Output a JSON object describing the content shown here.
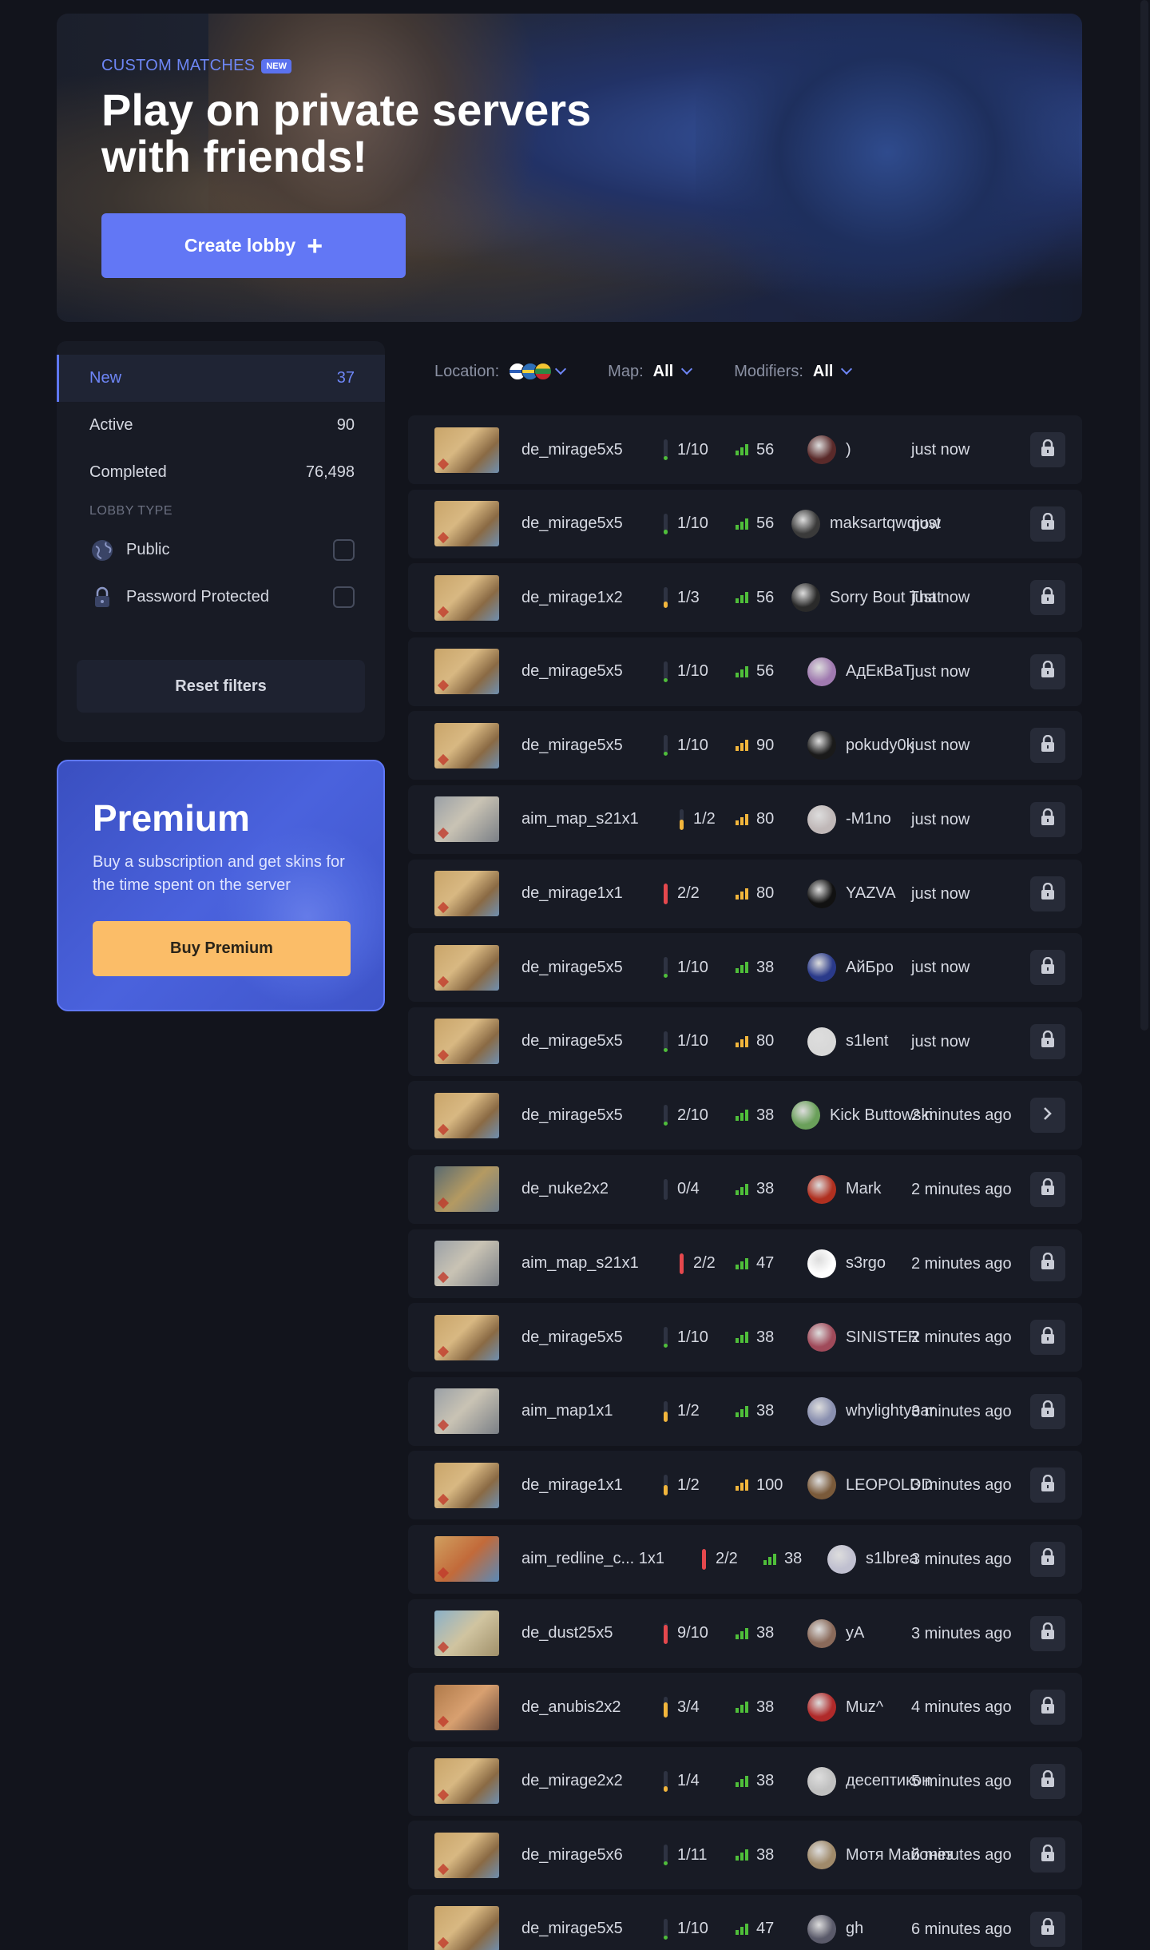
{
  "hero": {
    "eyebrow": "CUSTOM MATCHES",
    "badge": "NEW",
    "title": "Play on private servers with friends!",
    "create_button": "Create lobby",
    "create_icon": "plus-icon"
  },
  "sidebar": {
    "statuses": [
      {
        "label": "New",
        "count": "37",
        "active": true
      },
      {
        "label": "Active",
        "count": "90",
        "active": false
      },
      {
        "label": "Completed",
        "count": "76,498",
        "active": false
      }
    ],
    "lobby_type_label": "LOBBY TYPE",
    "types": [
      {
        "label": "Public",
        "icon": "globe-icon"
      },
      {
        "label": "Password Protected",
        "icon": "lock-icon"
      }
    ],
    "reset_label": "Reset filters"
  },
  "premium": {
    "title": "Premium",
    "text": "Buy a subscription and get skins for the time spent on the server",
    "button": "Buy Premium"
  },
  "filters": {
    "location_label": "Location:",
    "map_label": "Map:",
    "map_value": "All",
    "modifiers_label": "Modifiers:",
    "modifiers_value": "All"
  },
  "colors": {
    "accent": "#5f78f7",
    "premium_button": "#fbbd68",
    "ping_green": "#4fbf3a",
    "ping_yellow": "#f2b63c",
    "players_red": "#e5484d"
  },
  "lobbies": [
    {
      "map": "de_mirage5x5",
      "players": "1/10",
      "fill": 0.1,
      "ping": "56",
      "ping_color": "green",
      "host": ")",
      "time": "just now",
      "action": "lock-icon"
    },
    {
      "map": "de_mirage5x5",
      "players": "1/10",
      "fill": 0.1,
      "ping": "56",
      "ping_color": "green",
      "host": "maksartqwqjust",
      "time": "now",
      "action": "lock-icon"
    },
    {
      "map": "de_mirage1x2",
      "players": "1/3",
      "fill": 0.33,
      "ping": "56",
      "ping_color": "green",
      "host": "Sorry Bout That",
      "time": "just now",
      "action": "lock-icon"
    },
    {
      "map": "de_mirage5x5",
      "players": "1/10",
      "fill": 0.1,
      "ping": "56",
      "ping_color": "green",
      "host": "АдЕкВаТ",
      "time": "just now",
      "action": "lock-icon"
    },
    {
      "map": "de_mirage5x5",
      "players": "1/10",
      "fill": 0.1,
      "ping": "90",
      "ping_color": "yellow",
      "host": "pokudy0k",
      "time": "just now",
      "action": "lock-icon"
    },
    {
      "map": "aim_map_s21x1",
      "players": "1/2",
      "fill": 0.5,
      "ping": "80",
      "ping_color": "yellow",
      "host": "-M1no",
      "time": "just now",
      "action": "lock-icon"
    },
    {
      "map": "de_mirage1x1",
      "players": "2/2",
      "fill": 1.0,
      "ping": "80",
      "ping_color": "yellow",
      "host": "YAZVA",
      "time": "just now",
      "action": "lock-icon"
    },
    {
      "map": "de_mirage5x5",
      "players": "1/10",
      "fill": 0.1,
      "ping": "38",
      "ping_color": "green",
      "host": "АйБро",
      "time": "just now",
      "action": "lock-icon"
    },
    {
      "map": "de_mirage5x5",
      "players": "1/10",
      "fill": 0.1,
      "ping": "80",
      "ping_color": "yellow",
      "host": "s1lent",
      "time": "just now",
      "action": "lock-icon"
    },
    {
      "map": "de_mirage5x5",
      "players": "2/10",
      "fill": 0.2,
      "ping": "38",
      "ping_color": "green",
      "host": "Kick Buttowski",
      "time": "2 minutes ago",
      "action": "chevron-right-icon"
    },
    {
      "map": "de_nuke2x2",
      "players": "0/4",
      "fill": 0.0,
      "ping": "38",
      "ping_color": "green",
      "host": "Mark",
      "time": "2 minutes ago",
      "action": "lock-icon"
    },
    {
      "map": "aim_map_s21x1",
      "players": "2/2",
      "fill": 1.0,
      "ping": "47",
      "ping_color": "green",
      "host": "s3rgo",
      "time": "2 minutes ago",
      "action": "lock-icon"
    },
    {
      "map": "de_mirage5x5",
      "players": "1/10",
      "fill": 0.1,
      "ping": "38",
      "ping_color": "green",
      "host": "SINISTER",
      "time": "2 minutes ago",
      "action": "lock-icon"
    },
    {
      "map": "aim_map1x1",
      "players": "1/2",
      "fill": 0.5,
      "ping": "38",
      "ping_color": "green",
      "host": "whylightyear",
      "time": "3 minutes ago",
      "action": "lock-icon"
    },
    {
      "map": "de_mirage1x1",
      "players": "1/2",
      "fill": 0.5,
      "ping": "100",
      "ping_color": "yellow",
      "host": "LEOPOLDD",
      "time": "3 minutes ago",
      "action": "lock-icon"
    },
    {
      "map": "aim_redline_c... 1x1",
      "players": "2/2",
      "fill": 1.0,
      "ping": "38",
      "ping_color": "green",
      "host": "s1lbrea",
      "time": "3 minutes ago",
      "action": "lock-icon"
    },
    {
      "map": "de_dust25x5",
      "players": "9/10",
      "fill": 0.9,
      "ping": "38",
      "ping_color": "green",
      "host": "yA",
      "time": "3 minutes ago",
      "action": "lock-icon"
    },
    {
      "map": "de_anubis2x2",
      "players": "3/4",
      "fill": 0.75,
      "ping": "38",
      "ping_color": "green",
      "host": "Muz^",
      "time": "4 minutes ago",
      "action": "lock-icon"
    },
    {
      "map": "de_mirage2x2",
      "players": "1/4",
      "fill": 0.25,
      "ping": "38",
      "ping_color": "green",
      "host": "десептикон",
      "time": "5 minutes ago",
      "action": "lock-icon"
    },
    {
      "map": "de_mirage5x6",
      "players": "1/11",
      "fill": 0.09,
      "ping": "38",
      "ping_color": "green",
      "host": "Мотя Майонез",
      "time": "6 minutes ago",
      "action": "lock-icon"
    },
    {
      "map": "de_mirage5x5",
      "players": "1/10",
      "fill": 0.1,
      "ping": "47",
      "ping_color": "green",
      "host": "gh",
      "time": "6 minutes ago",
      "action": "lock-icon"
    }
  ]
}
